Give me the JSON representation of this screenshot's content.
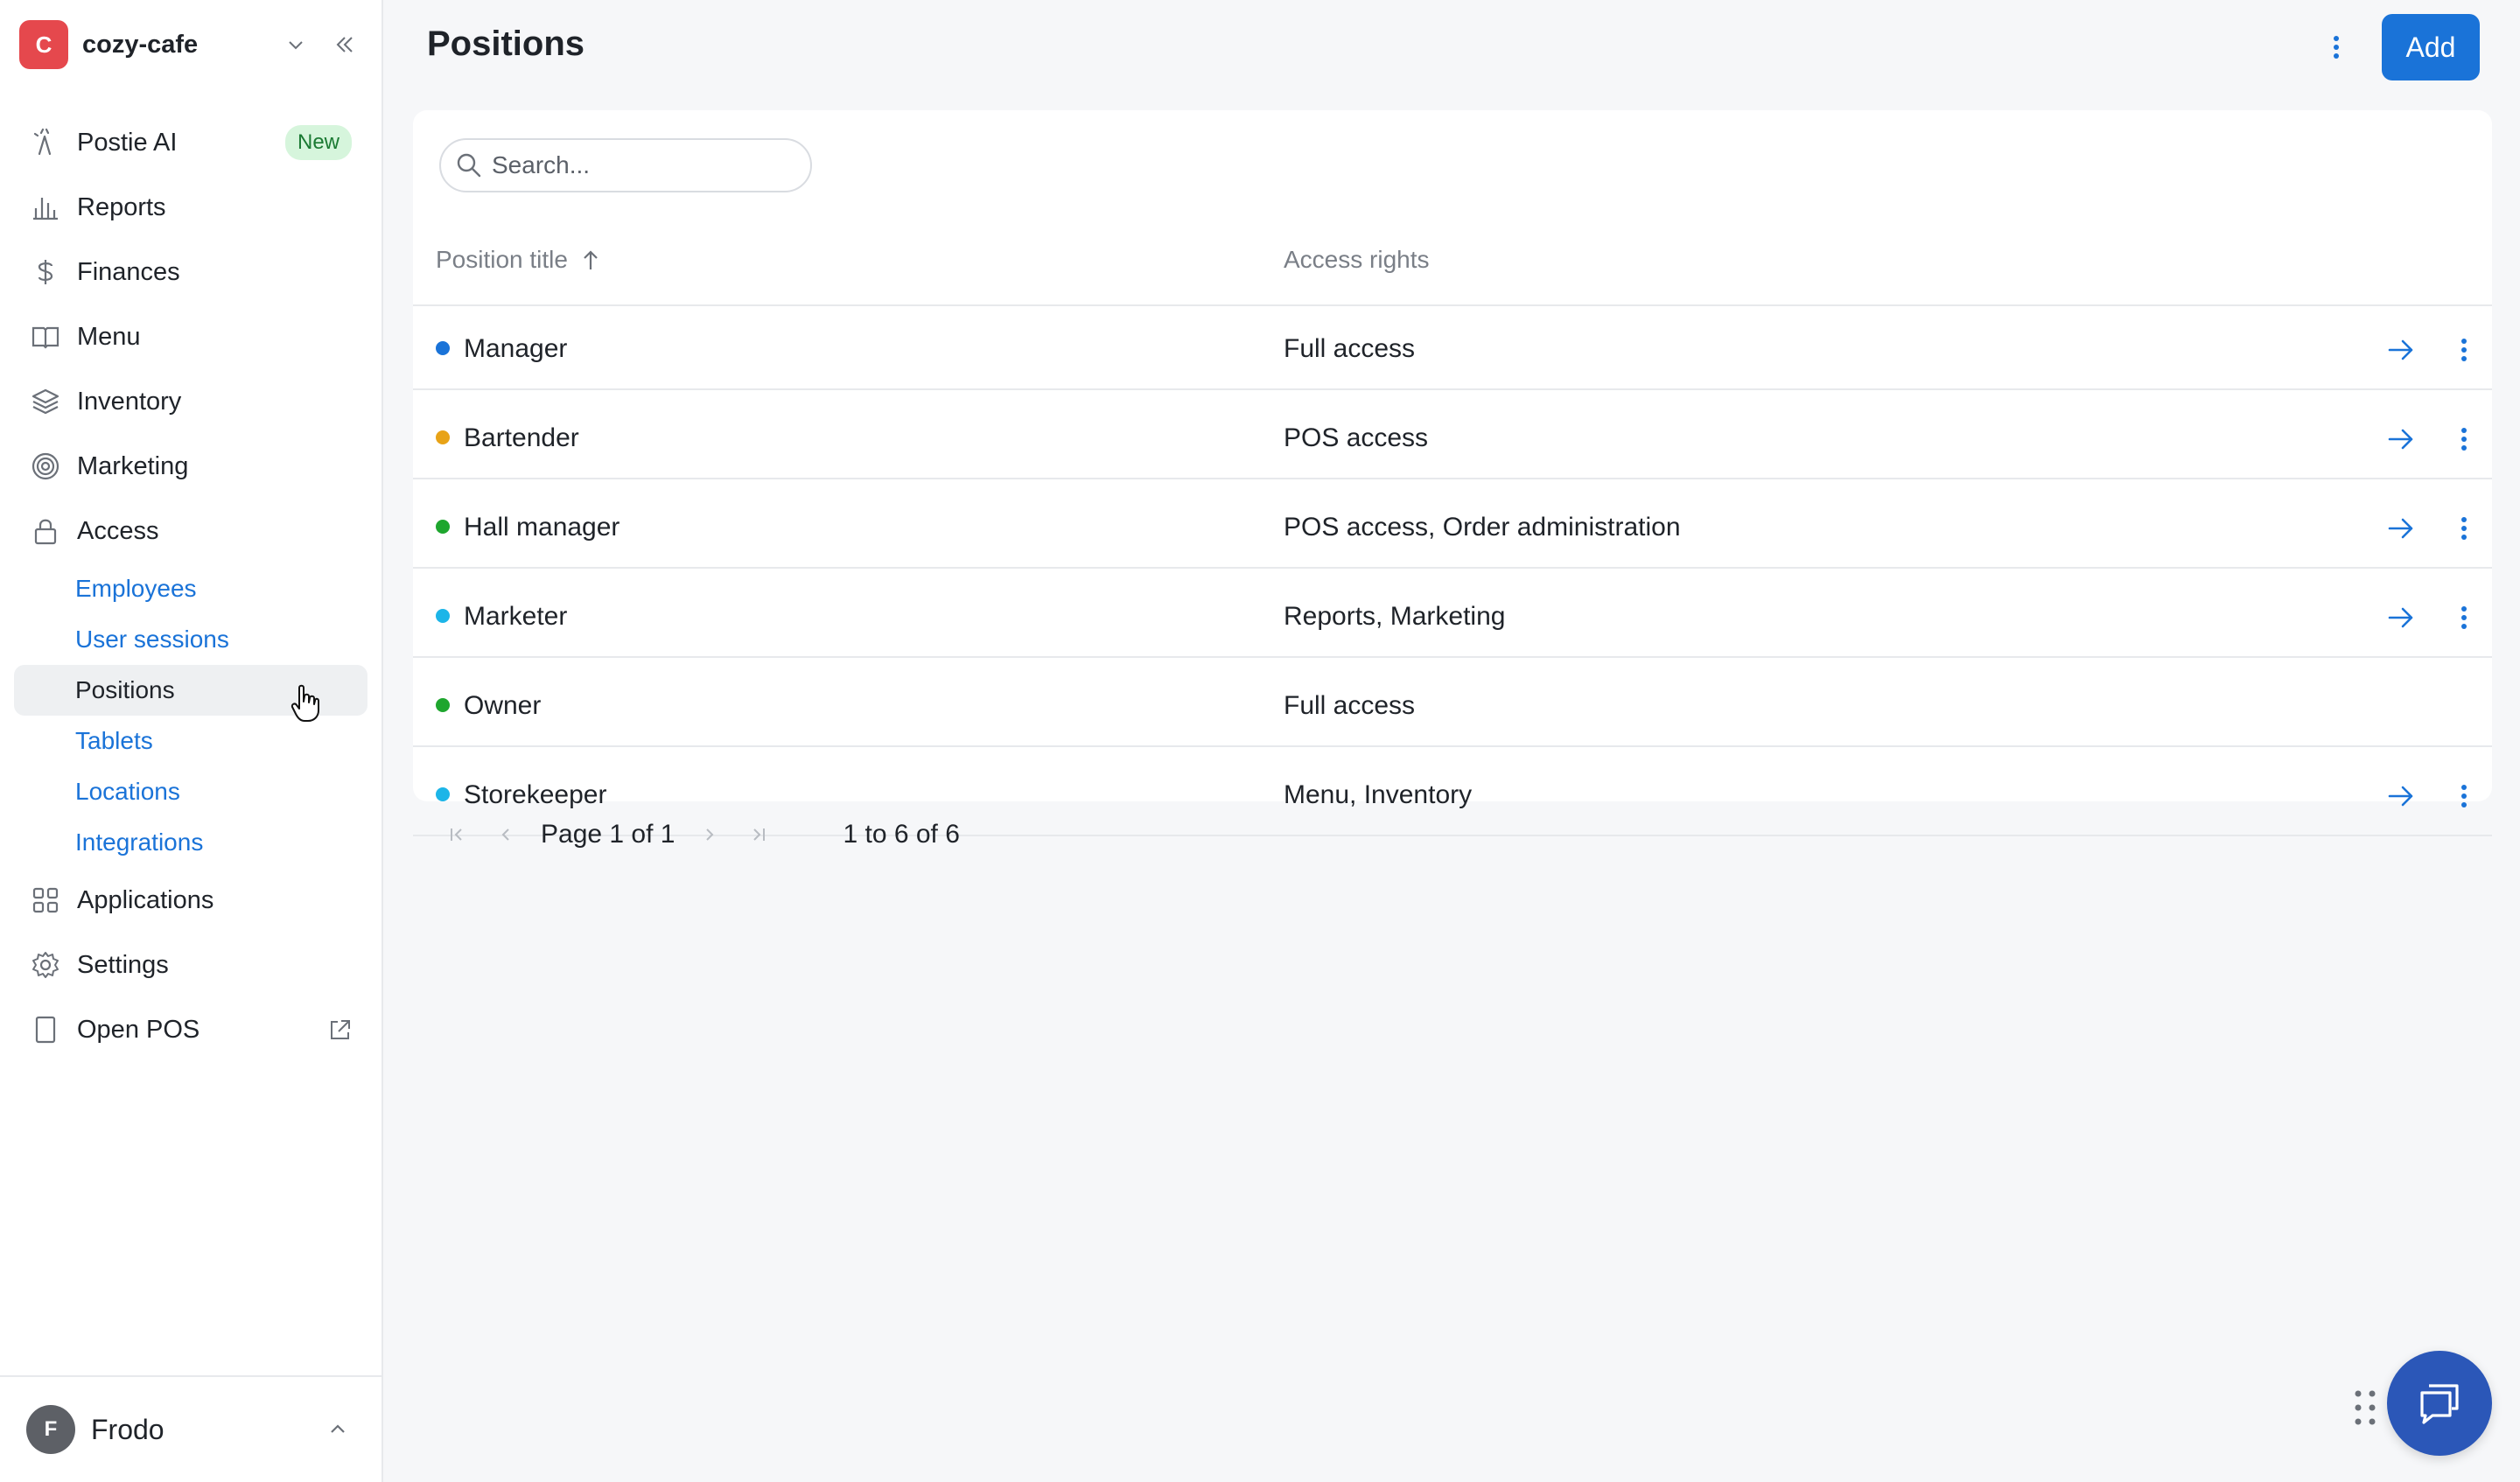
{
  "org": {
    "initial": "C",
    "name": "cozy-cafe",
    "avatar_color": "#e5484d"
  },
  "nav": {
    "postie_ai": {
      "label": "Postie AI",
      "badge": "New",
      "icon": "wand-icon"
    },
    "reports": {
      "label": "Reports",
      "icon": "bar-chart-icon"
    },
    "finances": {
      "label": "Finances",
      "icon": "dollar-icon"
    },
    "menu": {
      "label": "Menu",
      "icon": "book-icon"
    },
    "inventory": {
      "label": "Inventory",
      "icon": "layers-icon"
    },
    "marketing": {
      "label": "Marketing",
      "icon": "target-icon"
    },
    "access": {
      "label": "Access",
      "icon": "lock-icon",
      "sub": [
        "Employees",
        "User sessions",
        "Positions",
        "Tablets",
        "Locations",
        "Integrations"
      ],
      "active": "Positions"
    },
    "applications": {
      "label": "Applications",
      "icon": "grid-icon"
    },
    "settings": {
      "label": "Settings",
      "icon": "gear-icon"
    },
    "open_pos": {
      "label": "Open POS",
      "icon": "tablet-icon"
    }
  },
  "user": {
    "initial": "F",
    "name": "Frodo"
  },
  "header": {
    "title": "Positions",
    "add_label": "Add"
  },
  "search": {
    "placeholder": "Search..."
  },
  "table": {
    "columns": {
      "title": "Position title",
      "access": "Access rights"
    },
    "sort": "ascending",
    "rows": [
      {
        "title": "Manager",
        "access": "Full access",
        "color": "#1a73d8",
        "actions": true
      },
      {
        "title": "Bartender",
        "access": "POS access",
        "color": "#e8a317",
        "actions": true
      },
      {
        "title": "Hall manager",
        "access": "POS access, Order administration",
        "color": "#1ea62e",
        "actions": true
      },
      {
        "title": "Marketer",
        "access": "Reports, Marketing",
        "color": "#1cb5e8",
        "actions": true
      },
      {
        "title": "Owner",
        "access": "Full access",
        "color": "#1ea62e",
        "actions": false
      },
      {
        "title": "Storekeeper",
        "access": "Menu, Inventory",
        "color": "#1cb5e8",
        "actions": true
      }
    ]
  },
  "pagination": {
    "page_label": "Page 1 of 1",
    "range_label": "1 to 6 of 6"
  },
  "colors": {
    "accent": "#1a73d8",
    "chat": "#2b57b8"
  }
}
